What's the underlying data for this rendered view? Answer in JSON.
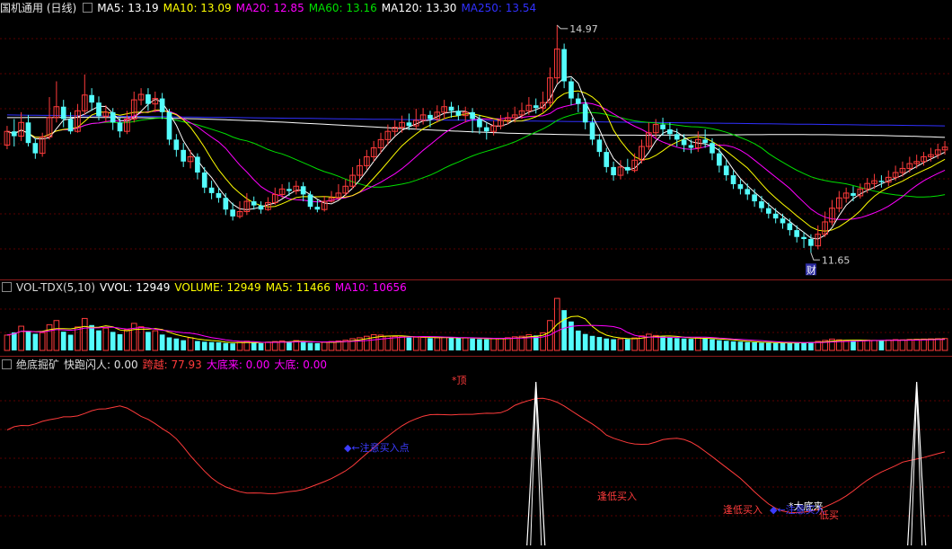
{
  "main_header": {
    "title": "国机通用 (日线)",
    "ma5": "MA5: 13.19",
    "ma10": "MA10: 13.09",
    "ma20": "MA20: 12.85",
    "ma60": "MA60: 13.16",
    "ma120": "MA120: 13.30",
    "ma250": "MA250: 13.54"
  },
  "vol_header": {
    "name": "VOL-TDX(5,10)",
    "vvol": "VVOL: 12949",
    "volume": "VOLUME: 12949",
    "ma5": "MA5: 11466",
    "ma10": "MA10: 10656"
  },
  "ind_header": {
    "name": "绝底掘矿",
    "kuaipao": "快跑闪人: 0.00",
    "kuayue": "跨越: 77.93",
    "dadilai": "大底来: 0.00",
    "dadi": "大底: 0.00"
  },
  "colors": {
    "up": "#ff3b3b",
    "down": "#54fcfc",
    "ma5": "#ffffff",
    "ma10": "#ffff00",
    "ma20": "#ff00ff",
    "ma60": "#00e000",
    "ma120": "#ffffff",
    "ma250": "#3030ff",
    "separator": "#8b1a1a",
    "grid": "#5a0000"
  },
  "chart_data": [
    {
      "type": "candlestick",
      "title": "国机通用 (日线)",
      "price_range": [
        11.65,
        14.97
      ],
      "high_marker": "14.97",
      "low_marker": "11.65",
      "event_label": "财",
      "series": [
        "MA5",
        "MA10",
        "MA20",
        "MA60",
        "MA120",
        "MA250"
      ],
      "candles": [
        [
          13.22,
          13.42,
          13.5,
          13.16
        ],
        [
          13.42,
          13.35,
          13.6,
          13.2
        ],
        [
          13.35,
          13.55,
          13.7,
          13.28
        ],
        [
          13.55,
          13.25,
          13.66,
          13.2
        ],
        [
          13.25,
          13.1,
          13.32,
          13.02
        ],
        [
          13.1,
          13.34,
          13.4,
          13.05
        ],
        [
          13.34,
          13.62,
          13.92,
          13.3
        ],
        [
          13.62,
          13.78,
          14.15,
          13.55
        ],
        [
          13.78,
          13.6,
          13.88,
          13.48
        ],
        [
          13.6,
          13.42,
          13.7,
          13.38
        ],
        [
          13.42,
          13.72,
          13.82,
          13.4
        ],
        [
          13.72,
          13.95,
          14.25,
          13.66
        ],
        [
          13.95,
          13.84,
          14.05,
          13.72
        ],
        [
          13.84,
          13.64,
          13.93,
          13.58
        ],
        [
          13.64,
          13.7,
          13.8,
          13.55
        ],
        [
          13.7,
          13.55,
          13.76,
          13.44
        ],
        [
          13.55,
          13.42,
          13.62,
          13.33
        ],
        [
          13.42,
          13.6,
          13.72,
          13.38
        ],
        [
          13.6,
          13.88,
          14.0,
          13.55
        ],
        [
          13.88,
          13.96,
          14.05,
          13.8
        ],
        [
          13.96,
          13.82,
          14.05,
          13.72
        ],
        [
          13.82,
          13.9,
          14.0,
          13.7
        ],
        [
          13.9,
          13.7,
          13.98,
          13.6
        ],
        [
          13.7,
          13.3,
          13.75,
          13.22
        ],
        [
          13.3,
          13.15,
          13.38,
          13.05
        ],
        [
          13.15,
          12.98,
          13.25,
          12.9
        ],
        [
          12.98,
          13.05,
          13.15,
          12.88
        ],
        [
          13.05,
          12.82,
          13.1,
          12.72
        ],
        [
          12.82,
          12.6,
          12.9,
          12.52
        ],
        [
          12.6,
          12.52,
          12.7,
          12.43
        ],
        [
          12.52,
          12.45,
          12.6,
          12.38
        ],
        [
          12.45,
          12.28,
          12.52,
          12.2
        ],
        [
          12.28,
          12.18,
          12.38,
          12.12
        ],
        [
          12.18,
          12.25,
          12.4,
          12.15
        ],
        [
          12.25,
          12.4,
          12.52,
          12.2
        ],
        [
          12.4,
          12.34,
          12.47,
          12.28
        ],
        [
          12.34,
          12.28,
          12.4,
          12.22
        ],
        [
          12.28,
          12.38,
          12.46,
          12.26
        ],
        [
          12.38,
          12.5,
          12.6,
          12.35
        ],
        [
          12.5,
          12.58,
          12.65,
          12.45
        ],
        [
          12.58,
          12.55,
          12.68,
          12.48
        ],
        [
          12.55,
          12.62,
          12.7,
          12.5
        ],
        [
          12.62,
          12.5,
          12.68,
          12.4
        ],
        [
          12.5,
          12.32,
          12.55,
          12.28
        ],
        [
          12.32,
          12.28,
          12.42,
          12.24
        ],
        [
          12.28,
          12.4,
          12.48,
          12.25
        ],
        [
          12.4,
          12.45,
          12.55,
          12.38
        ],
        [
          12.45,
          12.52,
          12.65,
          12.42
        ],
        [
          12.52,
          12.62,
          12.72,
          12.48
        ],
        [
          12.62,
          12.78,
          12.9,
          12.58
        ],
        [
          12.78,
          12.92,
          13.02,
          12.72
        ],
        [
          12.92,
          13.05,
          13.15,
          12.86
        ],
        [
          13.05,
          13.18,
          13.28,
          12.98
        ],
        [
          13.18,
          13.3,
          13.4,
          13.1
        ],
        [
          13.3,
          13.42,
          13.52,
          13.22
        ],
        [
          13.42,
          13.48,
          13.58,
          13.35
        ],
        [
          13.48,
          13.55,
          13.65,
          13.4
        ],
        [
          13.55,
          13.5,
          13.68,
          13.44
        ],
        [
          13.5,
          13.58,
          13.75,
          13.45
        ],
        [
          13.58,
          13.66,
          13.76,
          13.52
        ],
        [
          13.66,
          13.6,
          13.72,
          13.48
        ],
        [
          13.6,
          13.7,
          13.8,
          13.55
        ],
        [
          13.7,
          13.78,
          13.88,
          13.6
        ],
        [
          13.78,
          13.72,
          13.85,
          13.62
        ],
        [
          13.72,
          13.65,
          13.8,
          13.58
        ],
        [
          13.65,
          13.7,
          13.78,
          13.55
        ],
        [
          13.7,
          13.6,
          13.76,
          13.4
        ],
        [
          13.6,
          13.48,
          13.66,
          13.38
        ],
        [
          13.48,
          13.42,
          13.55,
          13.3
        ],
        [
          13.42,
          13.5,
          13.58,
          13.36
        ],
        [
          13.5,
          13.58,
          13.66,
          13.45
        ],
        [
          13.58,
          13.62,
          13.7,
          13.52
        ],
        [
          13.62,
          13.66,
          13.78,
          13.55
        ],
        [
          13.66,
          13.72,
          13.84,
          13.6
        ],
        [
          13.72,
          13.8,
          13.92,
          13.66
        ],
        [
          13.8,
          13.76,
          13.9,
          13.68
        ],
        [
          13.76,
          13.84,
          14.0,
          13.7
        ],
        [
          13.84,
          14.2,
          14.35,
          13.78
        ],
        [
          14.2,
          14.62,
          14.97,
          14.12
        ],
        [
          14.62,
          14.15,
          14.7,
          14.05
        ],
        [
          14.15,
          13.9,
          14.2,
          13.8
        ],
        [
          13.9,
          13.82,
          13.98,
          13.7
        ],
        [
          13.82,
          13.55,
          13.9,
          13.45
        ],
        [
          13.55,
          13.3,
          13.62,
          13.22
        ],
        [
          13.3,
          13.12,
          13.38,
          13.05
        ],
        [
          13.12,
          12.9,
          13.18,
          12.82
        ],
        [
          12.9,
          12.78,
          12.98,
          12.7
        ],
        [
          12.78,
          12.9,
          13.0,
          12.72
        ],
        [
          12.9,
          12.85,
          13.02,
          12.8
        ],
        [
          12.85,
          13.0,
          13.1,
          12.82
        ],
        [
          13.0,
          13.2,
          13.3,
          12.95
        ],
        [
          13.2,
          13.4,
          13.55,
          13.15
        ],
        [
          13.4,
          13.52,
          13.6,
          13.32
        ],
        [
          13.52,
          13.45,
          13.62,
          13.36
        ],
        [
          13.45,
          13.38,
          13.55,
          13.3
        ],
        [
          13.38,
          13.3,
          13.46,
          13.2
        ],
        [
          13.3,
          13.22,
          13.38,
          13.12
        ],
        [
          13.22,
          13.18,
          13.3,
          13.1
        ],
        [
          13.18,
          13.3,
          13.42,
          13.12
        ],
        [
          13.3,
          13.25,
          13.45,
          13.18
        ],
        [
          13.25,
          13.1,
          13.32,
          13.0
        ],
        [
          13.1,
          12.92,
          13.18,
          12.82
        ],
        [
          12.92,
          12.78,
          13.0,
          12.7
        ],
        [
          12.78,
          12.65,
          12.85,
          12.58
        ],
        [
          12.65,
          12.58,
          12.72,
          12.5
        ],
        [
          12.58,
          12.5,
          12.66,
          12.42
        ],
        [
          12.5,
          12.4,
          12.58,
          12.32
        ],
        [
          12.4,
          12.3,
          12.48,
          12.24
        ],
        [
          12.3,
          12.22,
          12.38,
          12.15
        ],
        [
          12.22,
          12.15,
          12.3,
          12.08
        ],
        [
          12.15,
          12.08,
          12.22,
          12.0
        ],
        [
          12.08,
          11.98,
          12.15,
          11.9
        ],
        [
          11.98,
          11.88,
          12.05,
          11.8
        ],
        [
          11.88,
          11.85,
          11.95,
          11.72
        ],
        [
          11.85,
          11.75,
          11.92,
          11.65
        ],
        [
          11.75,
          11.92,
          12.05,
          11.7
        ],
        [
          11.92,
          12.1,
          12.25,
          11.88
        ],
        [
          12.1,
          12.3,
          12.42,
          12.05
        ],
        [
          12.3,
          12.45,
          12.55,
          12.24
        ],
        [
          12.45,
          12.52,
          12.6,
          12.38
        ],
        [
          12.52,
          12.48,
          12.62,
          12.4
        ],
        [
          12.48,
          12.58,
          12.66,
          12.44
        ],
        [
          12.58,
          12.66,
          12.74,
          12.52
        ],
        [
          12.66,
          12.7,
          12.8,
          12.58
        ],
        [
          12.7,
          12.68,
          12.78,
          12.6
        ],
        [
          12.68,
          12.75,
          12.85,
          12.62
        ],
        [
          12.75,
          12.82,
          12.92,
          12.7
        ],
        [
          12.82,
          12.88,
          12.98,
          12.76
        ],
        [
          12.88,
          12.95,
          13.05,
          12.82
        ],
        [
          12.95,
          12.98,
          13.08,
          12.88
        ],
        [
          12.98,
          13.05,
          13.12,
          12.92
        ],
        [
          13.05,
          13.08,
          13.18,
          12.98
        ],
        [
          13.08,
          13.15,
          13.24,
          13.02
        ],
        [
          13.15,
          13.19,
          13.28,
          13.08
        ]
      ]
    },
    {
      "type": "bar",
      "title": "VOL-TDX(5,10)",
      "volumes": [
        8100,
        9500,
        12800,
        10200,
        8800,
        9400,
        13600,
        15800,
        9900,
        8300,
        12400,
        16900,
        13400,
        10600,
        11800,
        9800,
        8600,
        10900,
        14300,
        12500,
        9800,
        10400,
        8400,
        6900,
        6300,
        5400,
        6700,
        5000,
        4600,
        4400,
        4300,
        3900,
        3700,
        4300,
        4900,
        4200,
        3800,
        4400,
        4700,
        5000,
        4800,
        5200,
        4600,
        4000,
        3800,
        4300,
        4700,
        5000,
        5400,
        6200,
        6700,
        7500,
        8300,
        8100,
        7500,
        7400,
        7200,
        6800,
        7000,
        6900,
        6500,
        6700,
        6900,
        6800,
        6400,
        6600,
        6300,
        6000,
        5900,
        6200,
        6400,
        6700,
        7200,
        7500,
        8300,
        7900,
        9300,
        15800,
        27500,
        21300,
        15300,
        10500,
        8700,
        7700,
        7100,
        6300,
        5900,
        6100,
        6000,
        6600,
        7700,
        8600,
        7900,
        7300,
        6800,
        6500,
        6300,
        6100,
        6600,
        6500,
        5900,
        5400,
        5100,
        4800,
        4600,
        4400,
        4300,
        4100,
        4000,
        3900,
        3800,
        4000,
        4300,
        4100,
        4400,
        4800,
        5300,
        6000,
        5600,
        5300,
        5100,
        5200,
        5400,
        5300,
        5200,
        5500,
        5700,
        5600,
        5800,
        5900,
        6000,
        6100,
        6200,
        6300
      ]
    },
    {
      "type": "line",
      "title": "绝底掘矿",
      "y_range": [
        0,
        100
      ],
      "labels": [
        "*顶",
        "◆←注意买入点",
        "逢低买入",
        "逢低买入",
        "*大底来",
        "◆←注意买入",
        "低买"
      ]
    }
  ]
}
